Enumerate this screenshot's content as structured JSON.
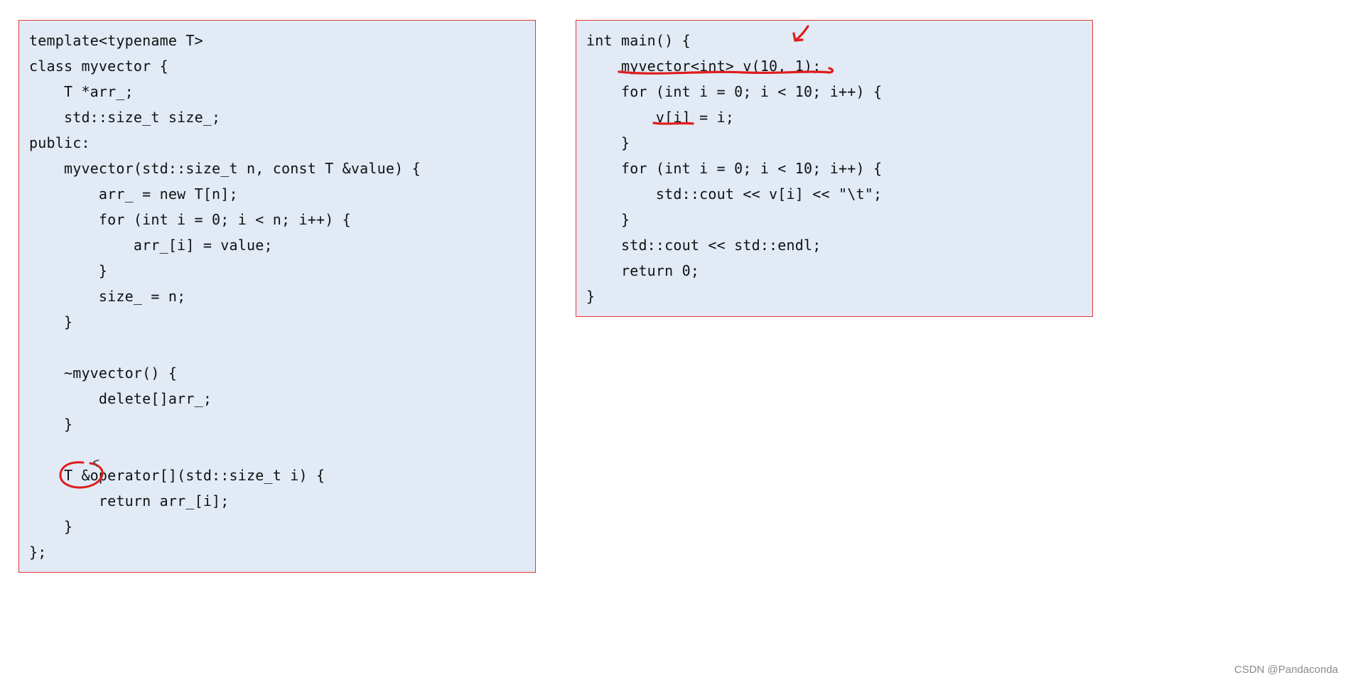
{
  "left": {
    "lines": [
      "template<typename T>",
      "class myvector {",
      "    T *arr_;",
      "    std::size_t size_;",
      "public:",
      "    myvector(std::size_t n, const T &value) {",
      "        arr_ = new T[n];",
      "        for (int i = 0; i < n; i++) {",
      "            arr_[i] = value;",
      "        }",
      "        size_ = n;",
      "    }",
      "",
      "    ~myvector() {",
      "        delete[]arr_;",
      "    }",
      "",
      "    T &operator[](std::size_t i) {",
      "        return arr_[i];",
      "    }",
      "};"
    ]
  },
  "right": {
    "lines": [
      "int main() {",
      "    myvector<int> v(10, 1);",
      "    for (int i = 0; i < 10; i++) {",
      "        v[i] = i;",
      "    }",
      "    for (int i = 0; i < 10; i++) {",
      "        std::cout << v[i] << \"\\t\";",
      "    }",
      "    std::cout << std::endl;",
      "    return 0;",
      "}"
    ]
  },
  "watermark": "CSDN @Pandaconda"
}
